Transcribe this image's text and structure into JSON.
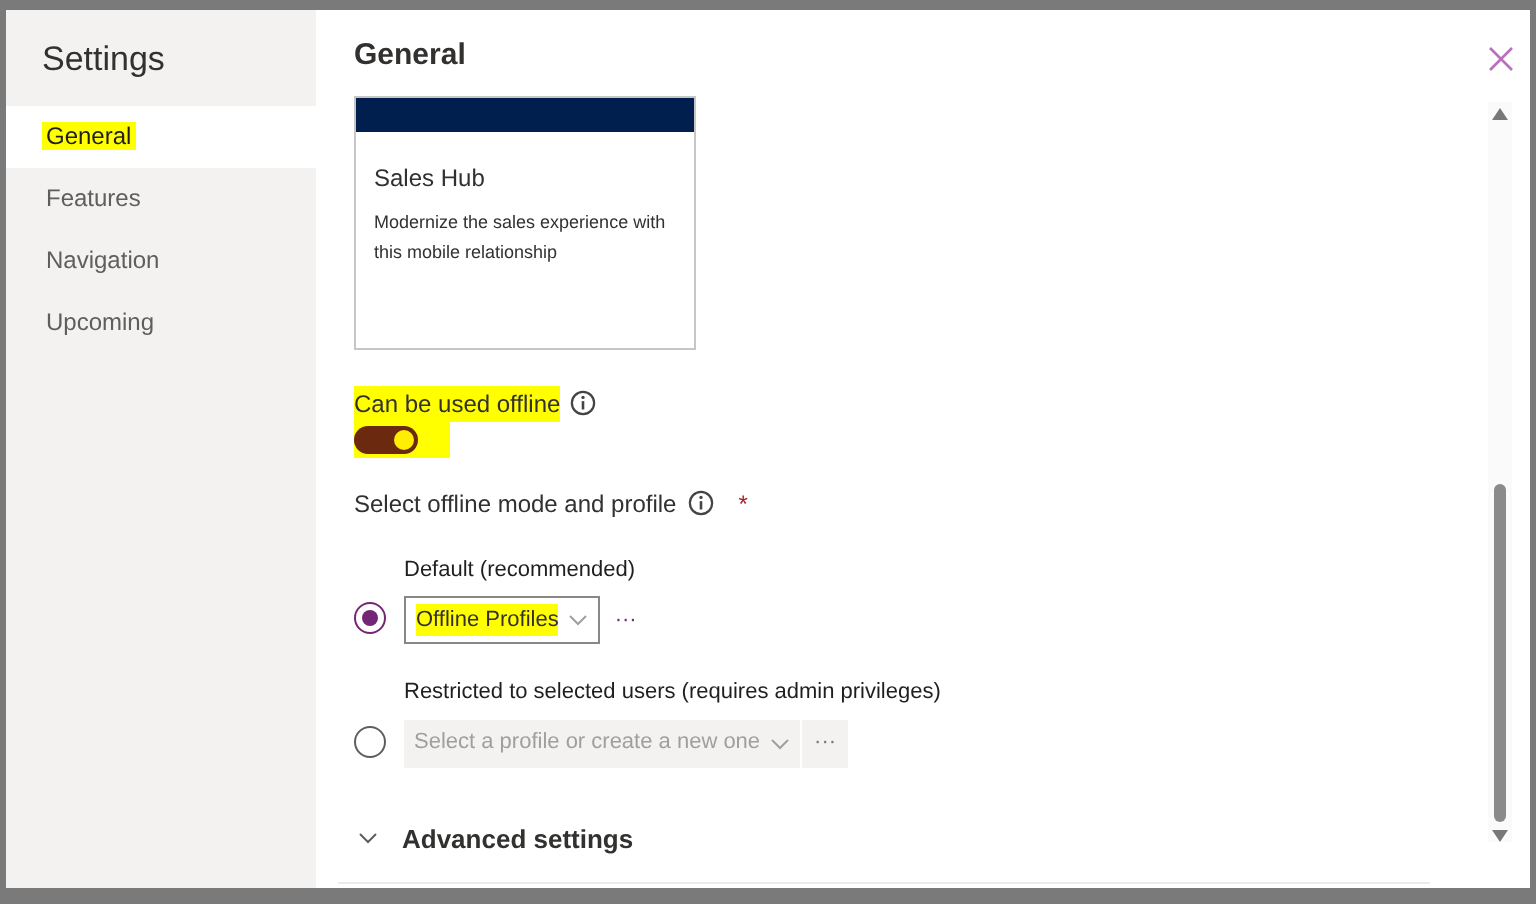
{
  "sidebar": {
    "title": "Settings",
    "items": [
      {
        "label": "General",
        "selected": true,
        "highlighted": true
      },
      {
        "label": "Features",
        "selected": false,
        "highlighted": false
      },
      {
        "label": "Navigation",
        "selected": false,
        "highlighted": false
      },
      {
        "label": "Upcoming",
        "selected": false,
        "highlighted": false
      }
    ]
  },
  "main": {
    "title": "General",
    "app_card": {
      "title": "Sales Hub",
      "description": "Modernize the sales experience with this mobile relationship"
    },
    "offline": {
      "label": "Can be used offline",
      "highlighted": true,
      "on": true
    },
    "mode": {
      "label": "Select offline mode and profile",
      "required_mark": "*",
      "options": [
        {
          "label": "Default (recommended)",
          "selected": true,
          "dropdown": "Offline Profiles",
          "dropdown_placeholder": false,
          "disabled": false,
          "highlighted": true,
          "more": "···"
        },
        {
          "label": "Restricted to selected users (requires admin privileges)",
          "selected": false,
          "dropdown": "Select a profile or create a new one",
          "dropdown_placeholder": true,
          "disabled": true,
          "highlighted": false,
          "more": "···"
        }
      ]
    },
    "advanced": {
      "label": "Advanced settings",
      "expanded": false
    }
  }
}
